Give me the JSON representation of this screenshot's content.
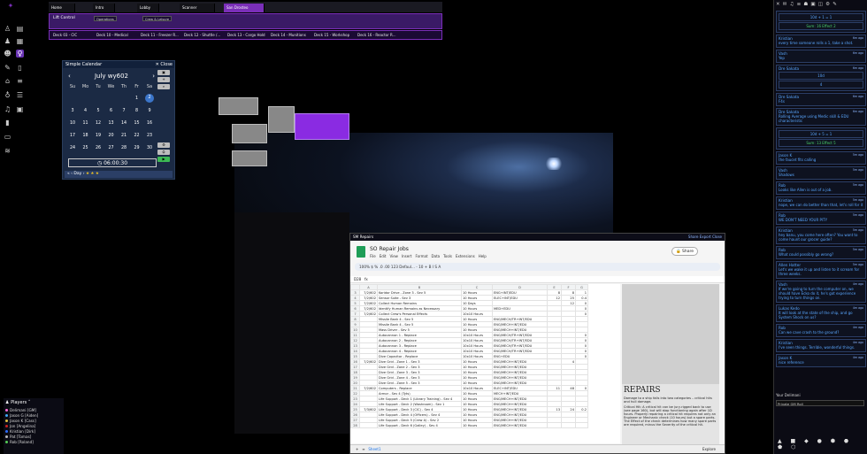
{
  "scene_tabs": [
    "Home",
    "Intro",
    "Lobby",
    "Scanner",
    "San Drosteo"
  ],
  "active_scene": "San Drosteo",
  "page_bar": {
    "lift_label": "Lift Control",
    "buttons": [
      "Operations",
      "Crew & Leisure"
    ]
  },
  "decks": [
    "Deck 03 - CIC",
    "Deck 10 - Medical",
    "Deck 11 - Freezer R...",
    "Deck 12 - Shuttle /...",
    "Deck 13 - Cargo Hold",
    "Deck 14 - Munitions",
    "Deck 15 - Workshop",
    "Deck 16 - Reactor R..."
  ],
  "left_tools": [
    "person-icon",
    "book-icon",
    "group-icon",
    "key-icon",
    "pencil-icon",
    "bank-icon",
    "lightbulb-icon",
    "music-icon",
    "bookmark-icon",
    "window-icon",
    "layers-icon"
  ],
  "calendar": {
    "title": "Simple Calendar",
    "close": "Close",
    "month": "July wy602",
    "weekdays": [
      "Su",
      "Mo",
      "Tu",
      "We",
      "Th",
      "Fr",
      "Sa"
    ],
    "days": [
      [
        "",
        "",
        "",
        "",
        "",
        "1",
        "2"
      ],
      [
        "3",
        "4",
        "5",
        "6",
        "7",
        "8",
        "9"
      ],
      [
        "10",
        "11",
        "12",
        "13",
        "14",
        "15",
        "16"
      ],
      [
        "17",
        "18",
        "19",
        "20",
        "21",
        "22",
        "23"
      ],
      [
        "24",
        "25",
        "26",
        "27",
        "28",
        "29",
        "30"
      ]
    ],
    "today": "2",
    "time": "06:00:30",
    "nav": "« ‹ Day ›"
  },
  "sheet": {
    "window_title": "SM Repairs",
    "window_actions": "Share  Export  Close",
    "title": "SO Repair Jobs",
    "menu": [
      "File",
      "Edit",
      "View",
      "Insert",
      "Format",
      "Data",
      "Tools",
      "Extensions",
      "Help"
    ],
    "share": "Share",
    "toolbar": "100%  $  %  .0  .00  123  Defaul...  -  10  +  B  I  S  A",
    "cell_ref": "D28",
    "col_headers": [
      "",
      "A",
      "B",
      "C",
      "D",
      "E",
      "F",
      "G"
    ],
    "rows": [
      [
        "3",
        "7/2/602",
        "Koridor Drive - Zone 3 - Sev 5",
        "10 Hours",
        "ENG+INT/EDU",
        "8",
        "8",
        "1"
      ],
      [
        "4",
        "7/2/602",
        "Sensor Suite - Sev 3",
        "10 Hours",
        "ELEC+INT/EDU",
        "12",
        "25",
        "0.4"
      ],
      [
        "5",
        "7/2/602",
        "Collect Human Remains",
        "10 Days",
        "",
        "",
        "12",
        "0"
      ],
      [
        "6",
        "7/2/602",
        "Identify Human Remains as Necessary",
        "10 Hours",
        "MED+EDU",
        "",
        "",
        "0"
      ],
      [
        "7",
        "7/2/602",
        "Collect Crew's Personal Effects",
        "10x10 Hours",
        "",
        "",
        "",
        "0"
      ],
      [
        "8",
        "",
        "Missile Bank 4 - Sev 5",
        "10 Hours",
        "ENG/MECH/TR+INT/EDU",
        "",
        "",
        ""
      ],
      [
        "9",
        "",
        "Missile Bank 4 - Sev 5",
        "10 Hours",
        "ENG/MECH+INT/EDU",
        "",
        "",
        ""
      ],
      [
        "10",
        "",
        "Mass Driver - Sev 5",
        "10 Hours",
        "ENG/MECH+INT/EDU",
        "",
        "",
        ""
      ],
      [
        "11",
        "",
        "Autocannon 1 - Replace",
        "10x10 Hours",
        "ENG/MECH/TR+INT/EDU",
        "",
        "",
        "0"
      ],
      [
        "12",
        "",
        "Autocannon 2 - Replace",
        "10x10 Hours",
        "ENG/MECH/TR+INT/EDU",
        "",
        "",
        "0"
      ],
      [
        "13",
        "",
        "Autocannon 3 - Replace",
        "10x10 Hours",
        "ENG/MECH/TR+INT/EDU",
        "",
        "",
        "0"
      ],
      [
        "14",
        "",
        "Autocannon 4 - Replace",
        "10x10 Hours",
        "ENG/MECH/TR+INT/EDU",
        "",
        "",
        "0"
      ],
      [
        "15",
        "",
        "Dive Capacitor - Replace",
        "10x10 Hours",
        "ENG+EDU",
        "",
        "",
        "0"
      ],
      [
        "16",
        "7/2/602",
        "Dive Grid - Zone 1 - Sev 3",
        "10 Hours",
        "ENG/MECH+INT/EDU",
        "",
        "4",
        ""
      ],
      [
        "17",
        "",
        "Dive Grid - Zone 2 - Sev 3",
        "10 Hours",
        "ENG/MECH+INT/EDU",
        "",
        "",
        ""
      ],
      [
        "18",
        "",
        "Dive Grid - Zone 3 - Sev 3",
        "10 Hours",
        "ENG/MECH+INT/EDU",
        "",
        "",
        ""
      ],
      [
        "19",
        "",
        "Dive Grid - Zone 4 - Sev 3",
        "10 Hours",
        "ENG/MECH+INT/EDU",
        "",
        "",
        ""
      ],
      [
        "20",
        "",
        "Dive Grid - Zone 5 - Sev 3",
        "10 Hours",
        "ENG/MECH+INT/EDU",
        "",
        "",
        ""
      ],
      [
        "21",
        "7/2/602",
        "Computers - Replace",
        "10x10 Hours",
        "ELEC+INT/EDU",
        "11",
        "48",
        "0"
      ],
      [
        "22",
        "",
        "Armor - Sev 4 (Tyts)",
        "10 Hours",
        "MECH+INT/EDU",
        "",
        "",
        ""
      ],
      [
        "23",
        "",
        "Life Support - Deck 1 (Library Training) - Sev 4",
        "10 Hours",
        "ENG/MECH+INT/EDU",
        "",
        "",
        ""
      ],
      [
        "24",
        "",
        "Life Support - Deck 2 (Washroom) - Sev 1",
        "10 Hours",
        "ENG/MECH+INT/EDU",
        "",
        "",
        ""
      ],
      [
        "25",
        "7/3/602",
        "Life Support - Deck 3 (CIC) - Sev 4",
        "10 Hours",
        "ENG/MECH+INT/EDU",
        "13",
        "24",
        "0.2"
      ],
      [
        "26",
        "",
        "Life Support - Deck 4 (Officers) - Sev 4",
        "10 Hours",
        "ENG/MECH+INT/EDU",
        "",
        "",
        ""
      ],
      [
        "27",
        "",
        "Life Support - Deck 5 (Crew A) - Sev 2",
        "10 Hours",
        "ENG/MECH+INT/EDU",
        "",
        "",
        ""
      ],
      [
        "28",
        "",
        "Life Support - Deck 6 (Galley) - Sev 4",
        "10 Hours",
        "ENG/MECH+INT/EDU",
        "",
        "",
        ""
      ]
    ],
    "repairs_heading": "REPAIRS",
    "repairs_text": "Damage to a ship falls into two categories – critical hits and hull damage.",
    "repairs_text2": "Critical Hit: A critical hit can be jury-rigged back to use (see page 160), but will stop functioning again after 1D hours. Properly repairing a critical hit requires not only an Engineer or Mechanic check (10 hours) but a spare parts. The Effect of the check determines how many spare parts are required, minus the Severity of the critical hit.",
    "tab": "Sheet1",
    "explore": "Explore"
  },
  "chat": {
    "icons": "✕ ✉ ♫ ≡ ☗ ▣ ◫ ⚙ ✎",
    "messages": [
      {
        "who": "",
        "when": "",
        "txt": "Sum: 16 Effect 2",
        "roll": "10d + 1 = 1"
      },
      {
        "who": "Kristian",
        "when": "6m ago",
        "txt": "every time someone rolls a 1, take a shot."
      },
      {
        "who": "Vash",
        "when": "6m ago",
        "txt": "Yep"
      },
      {
        "who": "Dre Sakata",
        "when": "6m ago",
        "txt": "",
        "roll": "10d",
        "roll2": "4"
      },
      {
        "who": "Dre Sakata",
        "when": "6m ago",
        "txt": "F4s"
      },
      {
        "who": "Dre Sakata",
        "when": "6m ago",
        "txt": "Rolling Average using Medic skill & EDU characteristic"
      },
      {
        "who": "",
        "when": "",
        "txt": "Sum: 13 Effect 5",
        "roll": "10d + 5 = 1"
      },
      {
        "who": "Jason K",
        "when": "5m ago",
        "txt": "the faucet fits calling"
      },
      {
        "who": "Vash",
        "when": "5m ago",
        "txt": "Shadows"
      },
      {
        "who": "Rob",
        "when": "5m ago",
        "txt": "Looks like Allen is out of a job."
      },
      {
        "who": "Kristian",
        "when": "5m ago",
        "txt": "nope, we can do better than that, let's roll for it"
      },
      {
        "who": "Rob",
        "when": "5m ago",
        "txt": "WE DON'T NEED YOUR PITY"
      },
      {
        "who": "Kristian",
        "when": "5m ago",
        "txt": "hey banu, you come here often? You want to come haunt our grocer guide?"
      },
      {
        "who": "Rob",
        "when": "5m ago",
        "txt": "What could possibly go wrong?"
      },
      {
        "who": "Allen Hatter",
        "when": "5m ago",
        "txt": "Let's we wake it up and listen to it scream for three weeks."
      },
      {
        "who": "Vash",
        "when": "4m ago",
        "txt": "If we're going to turn the computer on, we should have Ecko do it, he's got experience trying to turn things on."
      },
      {
        "who": "Lukas Kedo",
        "when": "4m ago",
        "txt": "It will look at the state of the ship, and go System Shock on us?"
      },
      {
        "who": "Rob",
        "when": "4m ago",
        "txt": "Can we cave crash to the ground?"
      },
      {
        "who": "Kristian",
        "when": "4m ago",
        "txt": "I've seen things. Terrible, wonderful things."
      },
      {
        "who": "Jason K",
        "when": "4m ago",
        "txt": "nice reference"
      }
    ],
    "foot_label": "Your Delimani",
    "input_label": "Private GM Roll"
  },
  "players": {
    "title": "Players",
    "list": [
      {
        "name": "Delimani [GM]",
        "color": "#ff6ad5"
      },
      {
        "name": "Jason G [Aiden]",
        "color": "#3fa9f5"
      },
      {
        "name": "Jason K [Cass]",
        "color": "#e0c040"
      },
      {
        "name": "Jon [Angelina]",
        "color": "#cc2222"
      },
      {
        "name": "Kristian [Dirk]",
        "color": "#2b6cff"
      },
      {
        "name": "Pat [Tomas]",
        "color": "#bbbbbb"
      },
      {
        "name": "Rob [Roland]",
        "color": "#55cc55"
      }
    ]
  }
}
